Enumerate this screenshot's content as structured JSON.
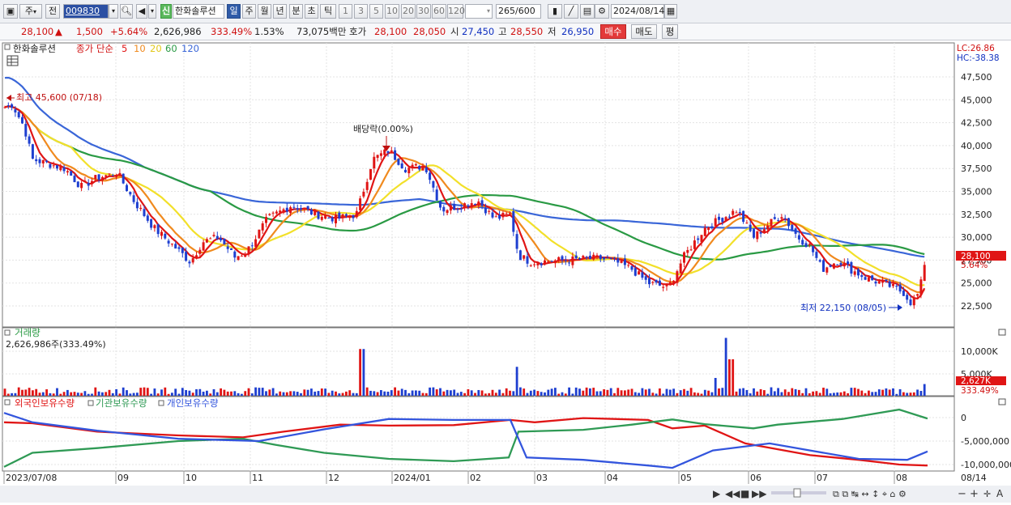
{
  "toolbar": {
    "period_select": "주",
    "prev_label": "전",
    "stock_code": "009830",
    "stock_name": "한화솔루션",
    "new_badge": "신",
    "periods": [
      "일",
      "주",
      "월",
      "년",
      "분",
      "초",
      "틱"
    ],
    "active_period": "일",
    "intervals": [
      "1",
      "3",
      "5",
      "10",
      "20",
      "30",
      "60",
      "120"
    ],
    "count": "265",
    "count_max": "/600",
    "date": "2024/08/14"
  },
  "quote": {
    "price": "28,100",
    "change_arrow": "▲",
    "change": "1,500",
    "change_pct": "+5.64%",
    "volume": "2,626,986",
    "volume_ratio": "333.49%",
    "turnover": "1.53%",
    "trade_value": "73,075백만",
    "hoga_label": "호가",
    "ask": "28,100",
    "bid": "28,050",
    "open_label": "시",
    "open": "27,450",
    "high_label": "고",
    "high": "28,550",
    "low_label": "저",
    "low": "26,950",
    "buy_btn": "매수",
    "sell_btn": "매도",
    "eval_btn": "평"
  },
  "price_panel": {
    "name": "한화솔루션",
    "ma_title": "종가 단순",
    "ma_periods": [
      "5",
      "10",
      "20",
      "60",
      "120"
    ],
    "ma_colors": [
      "#e01515",
      "#f08a1e",
      "#f2e02a",
      "#2a9a44",
      "#3a66d8"
    ],
    "lc_label": "LC:26.86",
    "hc_label": "HC:-38.38",
    "y_ticks": [
      "47,500",
      "45,000",
      "42,500",
      "40,000",
      "37,500",
      "35,000",
      "32,500",
      "30,000",
      "27,500",
      "25,000",
      "22,500"
    ],
    "y_values": [
      47500,
      45000,
      42500,
      40000,
      37500,
      35000,
      32500,
      30000,
      27500,
      25000,
      22500
    ],
    "last_price_tag": "28,100",
    "last_change_tag": "5.64%",
    "high_annot": "최고 45,600 (07/18)",
    "low_annot": "최저 22,150 (08/05)",
    "dividend_annot": "배당락(0.00%)"
  },
  "volume_panel": {
    "title": "거래량",
    "value": "2,626,986주(333.49%)",
    "y_ticks": [
      "10,000K",
      "5,000K"
    ],
    "last_tag": "2,627K",
    "last_pct": "333.49%"
  },
  "holder_panel": {
    "series": [
      "외국인보유수량",
      "기관보유수량",
      "개인보유수량"
    ],
    "colors": [
      "#e01515",
      "#2f9a55",
      "#3355dd"
    ],
    "y_ticks": [
      "0",
      "-5,000,000",
      "-10,000,000"
    ]
  },
  "x_axis": {
    "labels": [
      "2023/07/08",
      "09",
      "10",
      "11",
      "12",
      "2024/01",
      "02",
      "03",
      "04",
      "05",
      "06",
      "07",
      "08"
    ],
    "end_label": "08/14"
  }
}
